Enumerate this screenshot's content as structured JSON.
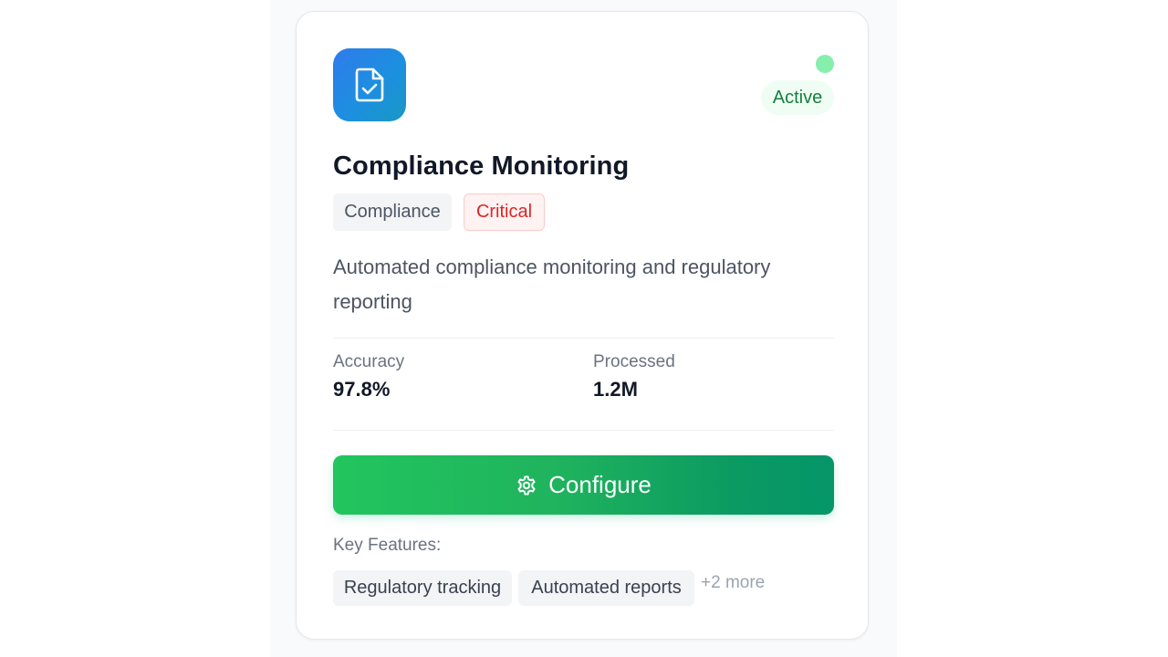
{
  "card": {
    "title": "Compliance Monitoring",
    "icon": "document-check-icon",
    "status": {
      "label": "Active",
      "color": "#15803d",
      "dot_color": "#86efac"
    },
    "tags": {
      "category": "Compliance",
      "priority": "Critical",
      "priority_color": "#dc2626"
    },
    "description": "Automated compliance monitoring and regulatory reporting",
    "stats": [
      {
        "label": "Accuracy",
        "value": "97.8%"
      },
      {
        "label": "Processed",
        "value": "1.2M"
      }
    ],
    "action": {
      "label": "Configure",
      "icon": "gear-icon",
      "gradient": [
        "#22c55e",
        "#059669"
      ]
    },
    "features": {
      "label": "Key Features:",
      "items": [
        "Regulatory tracking",
        "Automated reports"
      ],
      "more": "+2 more"
    }
  }
}
